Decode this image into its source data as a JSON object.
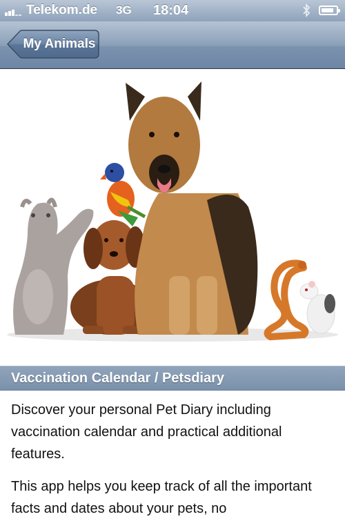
{
  "status_bar": {
    "carrier": "Telekom.de",
    "network": "3G",
    "time": "18:04",
    "icons": [
      "signal-icon",
      "bluetooth-icon",
      "battery-icon"
    ],
    "battery_level_fraction": 0.85
  },
  "nav": {
    "back_label": "My Animals",
    "colors": {
      "bar": "#7c93af",
      "button": "#5a7393"
    }
  },
  "hero": {
    "image": "photo of a cat, parrot, dachshund, german shepherd dog, snake and rat"
  },
  "section": {
    "title": "Vaccination Calendar / Petsdiary",
    "color": "#7b91ab"
  },
  "content": {
    "paragraphs": [
      "Discover your personal Pet Diary including vaccination calendar and practical additional features.",
      "This app helps you keep track of all the important facts and dates about your pets, no"
    ]
  }
}
